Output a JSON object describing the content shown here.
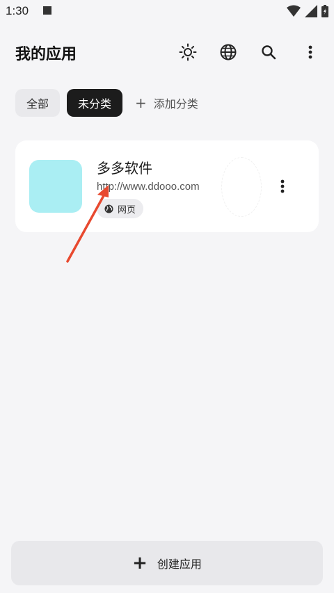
{
  "status": {
    "time": "1:30"
  },
  "header": {
    "title": "我的应用"
  },
  "tabs": [
    {
      "label": "全部"
    },
    {
      "label": "未分类"
    },
    {
      "label": "添加分类"
    }
  ],
  "app": {
    "name": "多多软件",
    "url": "http://www.ddooo.com",
    "badge": "网页",
    "icon_color": "#aaeef3"
  },
  "create": {
    "label": "创建应用"
  },
  "colors": {
    "background": "#f5f5f7",
    "active_tab": "#1c1c1c",
    "annotation_arrow": "#e8492f"
  }
}
